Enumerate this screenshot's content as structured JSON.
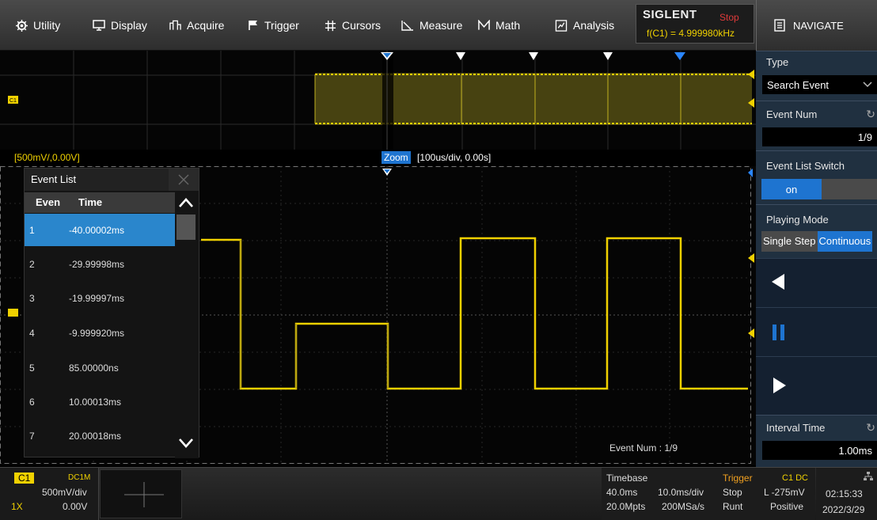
{
  "menu": {
    "items": [
      {
        "label": "Utility",
        "icon": "gear-icon"
      },
      {
        "label": "Display",
        "icon": "display-icon"
      },
      {
        "label": "Acquire",
        "icon": "acquire-icon"
      },
      {
        "label": "Trigger",
        "icon": "flag-icon"
      },
      {
        "label": "Cursors",
        "icon": "cursors-icon"
      },
      {
        "label": "Measure",
        "icon": "measure-icon"
      },
      {
        "label": "Math",
        "icon": "math-icon"
      },
      {
        "label": "Analysis",
        "icon": "analysis-icon"
      }
    ]
  },
  "brand": {
    "logo": "SIGLENT",
    "run_state": "Stop",
    "frequency": "f(C1) = 4.999980kHz"
  },
  "navigate": {
    "title": "NAVIGATE",
    "type_label": "Type",
    "type_value": "Search Event",
    "event_num_label": "Event Num",
    "event_num_value": "1/9",
    "event_list_switch_label": "Event List Switch",
    "event_list_switch_value": "on",
    "playing_mode_label": "Playing Mode",
    "mode_single": "Single Step",
    "mode_continuous": "Continuous",
    "interval_time_label": "Interval Time",
    "interval_time_value": "1.00ms"
  },
  "channel_label": {
    "scale_offset": "[500mV/,0.00V]",
    "marker": "C1"
  },
  "zoom": {
    "badge": "Zoom",
    "setting": "[100us/div, 0.00s]"
  },
  "event_list": {
    "title": "Event List",
    "col_event": "Even",
    "col_time": "Time",
    "rows": [
      {
        "n": "1",
        "time": "-40.00002ms"
      },
      {
        "n": "2",
        "time": "-29.99998ms"
      },
      {
        "n": "3",
        "time": "-19.99997ms"
      },
      {
        "n": "4",
        "time": "-9.999920ms"
      },
      {
        "n": "5",
        "time": "85.00000ns"
      },
      {
        "n": "6",
        "time": "10.00013ms"
      },
      {
        "n": "7",
        "time": "20.00018ms"
      }
    ]
  },
  "event_num_overlay": "Event Num : 1/9",
  "bottom": {
    "ch": "C1",
    "coupling": "DC1M",
    "scale": "500mV/div",
    "probe": "1X",
    "offset": "0.00V",
    "timebase_label": "Timebase",
    "delay": "40.0ms",
    "tdiv": "10.0ms/div",
    "mem": "20.0Mpts",
    "srate": "200MSa/s",
    "trigger_label": "Trigger",
    "trig_state": "Stop",
    "trig_type": "Runt",
    "trig_src": "C1 DC",
    "trig_level": "L -275mV",
    "trig_slope": "Positive",
    "time": "02:15:33",
    "date": "2022/3/29",
    "network_icon": "network-icon"
  }
}
